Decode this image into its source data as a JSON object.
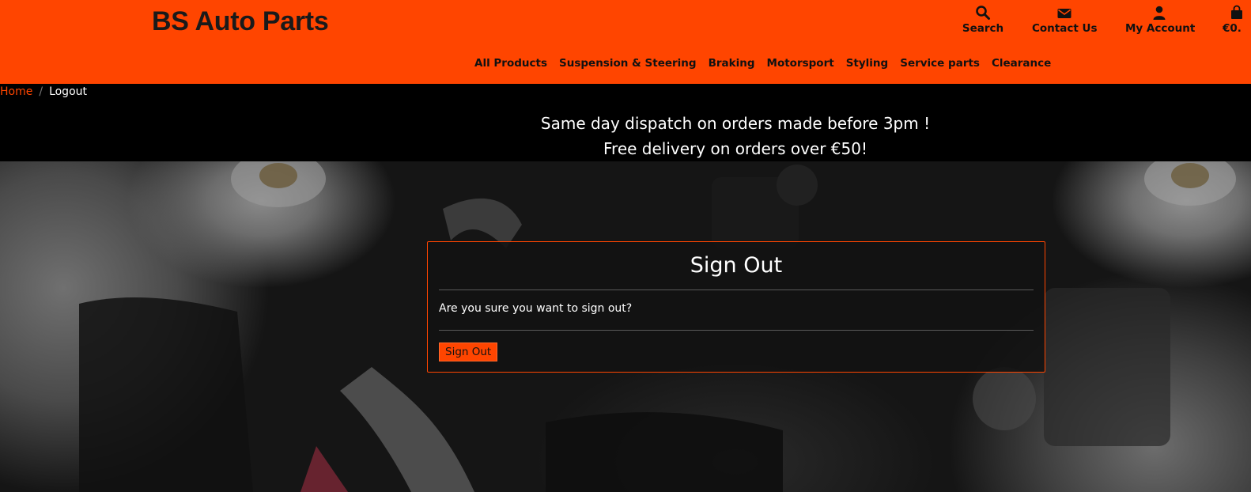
{
  "brand": {
    "name": "BS Auto Parts"
  },
  "header_utils": {
    "search": {
      "label": "Search",
      "icon": "search-icon"
    },
    "contact": {
      "label": "Contact Us",
      "icon": "envelope-icon"
    },
    "account": {
      "label": "My Account",
      "icon": "user-icon"
    },
    "bag": {
      "label": "€0.",
      "icon": "shopping-bag-icon"
    }
  },
  "nav": {
    "items": [
      {
        "label": "All Products"
      },
      {
        "label": "Suspension & Steering"
      },
      {
        "label": "Braking"
      },
      {
        "label": "Motorsport"
      },
      {
        "label": "Styling"
      },
      {
        "label": "Service parts"
      },
      {
        "label": "Clearance"
      }
    ]
  },
  "breadcrumb": {
    "home": "Home",
    "separator": "/",
    "current": "Logout"
  },
  "banner": {
    "line1": "Same day dispatch on orders made before 3pm !",
    "line2": "Free delivery on orders over €50!"
  },
  "modal": {
    "title": "Sign Out",
    "message": "Are you sure you want to sign out?",
    "button": "Sign Out"
  },
  "colors": {
    "accent": "#ff4500",
    "header_bg": "#ff4500",
    "banner_bg": "#000000",
    "modal_border": "#ff4500"
  }
}
